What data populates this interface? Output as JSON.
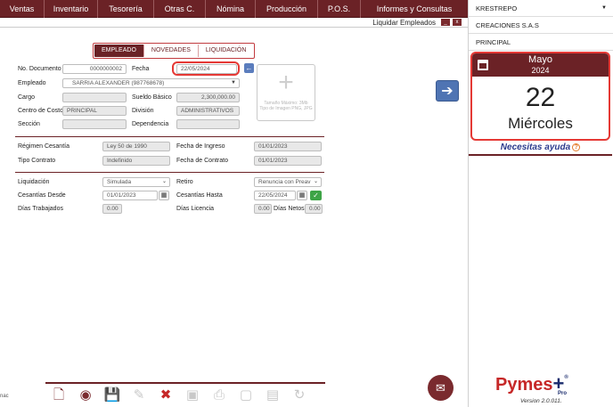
{
  "menubar": {
    "items": [
      "Ventas",
      "Inventario",
      "Tesorería",
      "Otras C.",
      "Nómina",
      "Producción",
      "P.O.S.",
      "Informes y Consultas"
    ]
  },
  "window": {
    "title": "Liquidar Empleados",
    "minimize": "_",
    "close": "x"
  },
  "tabs": [
    "EMPLEADO",
    "NOVEDADES",
    "LIQUIDACIÓN"
  ],
  "form": {
    "doc_label": "No. Documento",
    "doc_value": "0000000002",
    "fecha_label": "Fecha",
    "fecha_value": "22/05/2024",
    "empleado_label": "Empleado",
    "empleado_value": "SARRIA ALEXANDER (987768678)",
    "cargo_label": "Cargo",
    "cargo_value": "",
    "sueldo_label": "Sueldo Básico",
    "sueldo_value": "2,300,000.00",
    "centro_label": "Centro de Costo",
    "centro_value": "PRINCIPAL",
    "division_label": "División",
    "division_value": "ADMINISTRATIVOS",
    "seccion_label": "Sección",
    "seccion_value": "",
    "dependencia_label": "Dependencia",
    "dependencia_value": "",
    "image_caption": "Tamaño Máximo: 3Mb Tipo de Imagen PNG, JPG"
  },
  "contract": {
    "regimen_label": "Régimen Cesantía",
    "regimen_value": "Ley 50 de 1990",
    "ingreso_label": "Fecha de Ingreso",
    "ingreso_value": "01/01/2023",
    "tipo_label": "Tipo Contrato",
    "tipo_value": "Indefinido",
    "fcontrato_label": "Fecha de Contrato",
    "fcontrato_value": "01/01/2023"
  },
  "liquidation": {
    "liq_label": "Liquidación",
    "liq_value": "Simulada",
    "retiro_label": "Retiro",
    "retiro_value": "Renuncia con Preav",
    "desde_label": "Cesantías Desde",
    "desde_value": "01/01/2023",
    "hasta_label": "Cesantías Hasta",
    "hasta_value": "22/05/2024",
    "trab_label": "Días Trabajados",
    "trab_value": "0.00",
    "lic_label": "Días Licencia",
    "lic_value": "0.00",
    "netos_label": "Días Netos",
    "netos_value": "0.00"
  },
  "right": {
    "user": "KRESTREPO",
    "company": "CREACIONES S.A.S",
    "branch": "PRINCIPAL",
    "cal_month": "Mayo",
    "cal_year": "2024",
    "cal_day": "22",
    "cal_weekday": "Miércoles",
    "help": "Necesitas ayuda",
    "logo": "Pymes",
    "pro": "Pro",
    "version": "Version 2.0.011."
  },
  "left_fragment": "nac",
  "colors": {
    "brand": "#6b2226",
    "highlight": "#e53935",
    "accent_blue": "#4f74b3"
  }
}
